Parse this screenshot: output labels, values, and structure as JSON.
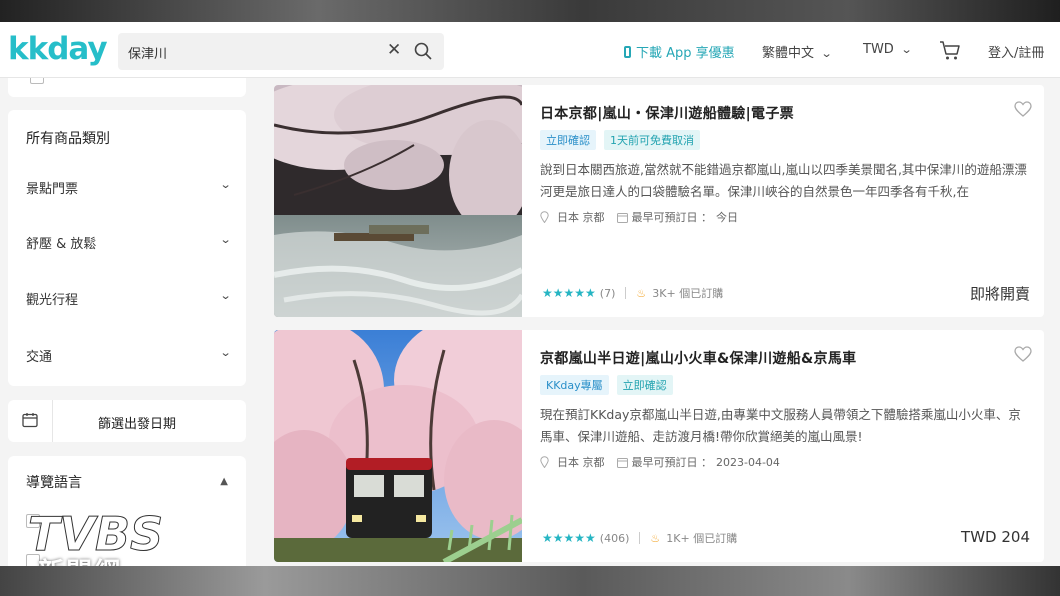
{
  "header": {
    "logo": "kkday",
    "search_value": "保津川",
    "clear_glyph": "✕",
    "app_download": "下載 App 享優惠",
    "language": "繁體中文",
    "currency": "TWD",
    "login": "登入/註冊"
  },
  "sidebar": {
    "categories_title": "所有商品類別",
    "categories": [
      "景點門票",
      "舒壓 & 放鬆",
      "觀光行程",
      "交通"
    ],
    "date_filter": "篩選出發日期",
    "language_title": "導覽語言"
  },
  "products": [
    {
      "title": "日本京都|嵐山・保津川遊船體驗|電子票",
      "tags": [
        "立即確認",
        "1天前可免費取消"
      ],
      "description": "說到日本關西旅遊,當然就不能錯過京都嵐山,嵐山以四季美景聞名,其中保津川的遊船漂漂河更是旅日達人的口袋體驗名單。保津川峽谷的自然景色一年四季各有千秋,在",
      "location": "日本 京都",
      "earliest_label": "最早可預訂日 ：",
      "earliest_value": "今日",
      "stars": "★★★★★",
      "reviews": "(7)",
      "booked": "3K+ 個已訂購",
      "price": "即將開賣"
    },
    {
      "title": "京都嵐山半日遊|嵐山小火車&保津川遊船&京馬車",
      "tags": [
        "KKday專屬",
        "立即確認"
      ],
      "description": "現在預訂KKday京都嵐山半日遊,由專業中文服務人員帶領之下體驗搭乘嵐山小火車、京馬車、保津川遊船、走訪渡月橋!帶你欣賞絕美的嵐山風景!",
      "location": "日本 京都",
      "earliest_label": "最早可預訂日 ：",
      "earliest_value": "2023-04-04",
      "stars": "★★★★★",
      "reviews": "(406)",
      "booked": "1K+ 個已訂購",
      "price": "TWD 204"
    }
  ],
  "watermark": {
    "brand": "TVBS",
    "name": "新聞網"
  },
  "colors": {
    "accent": "#26bec9",
    "star": "#26b5c3",
    "fire": "#f3a62b"
  }
}
